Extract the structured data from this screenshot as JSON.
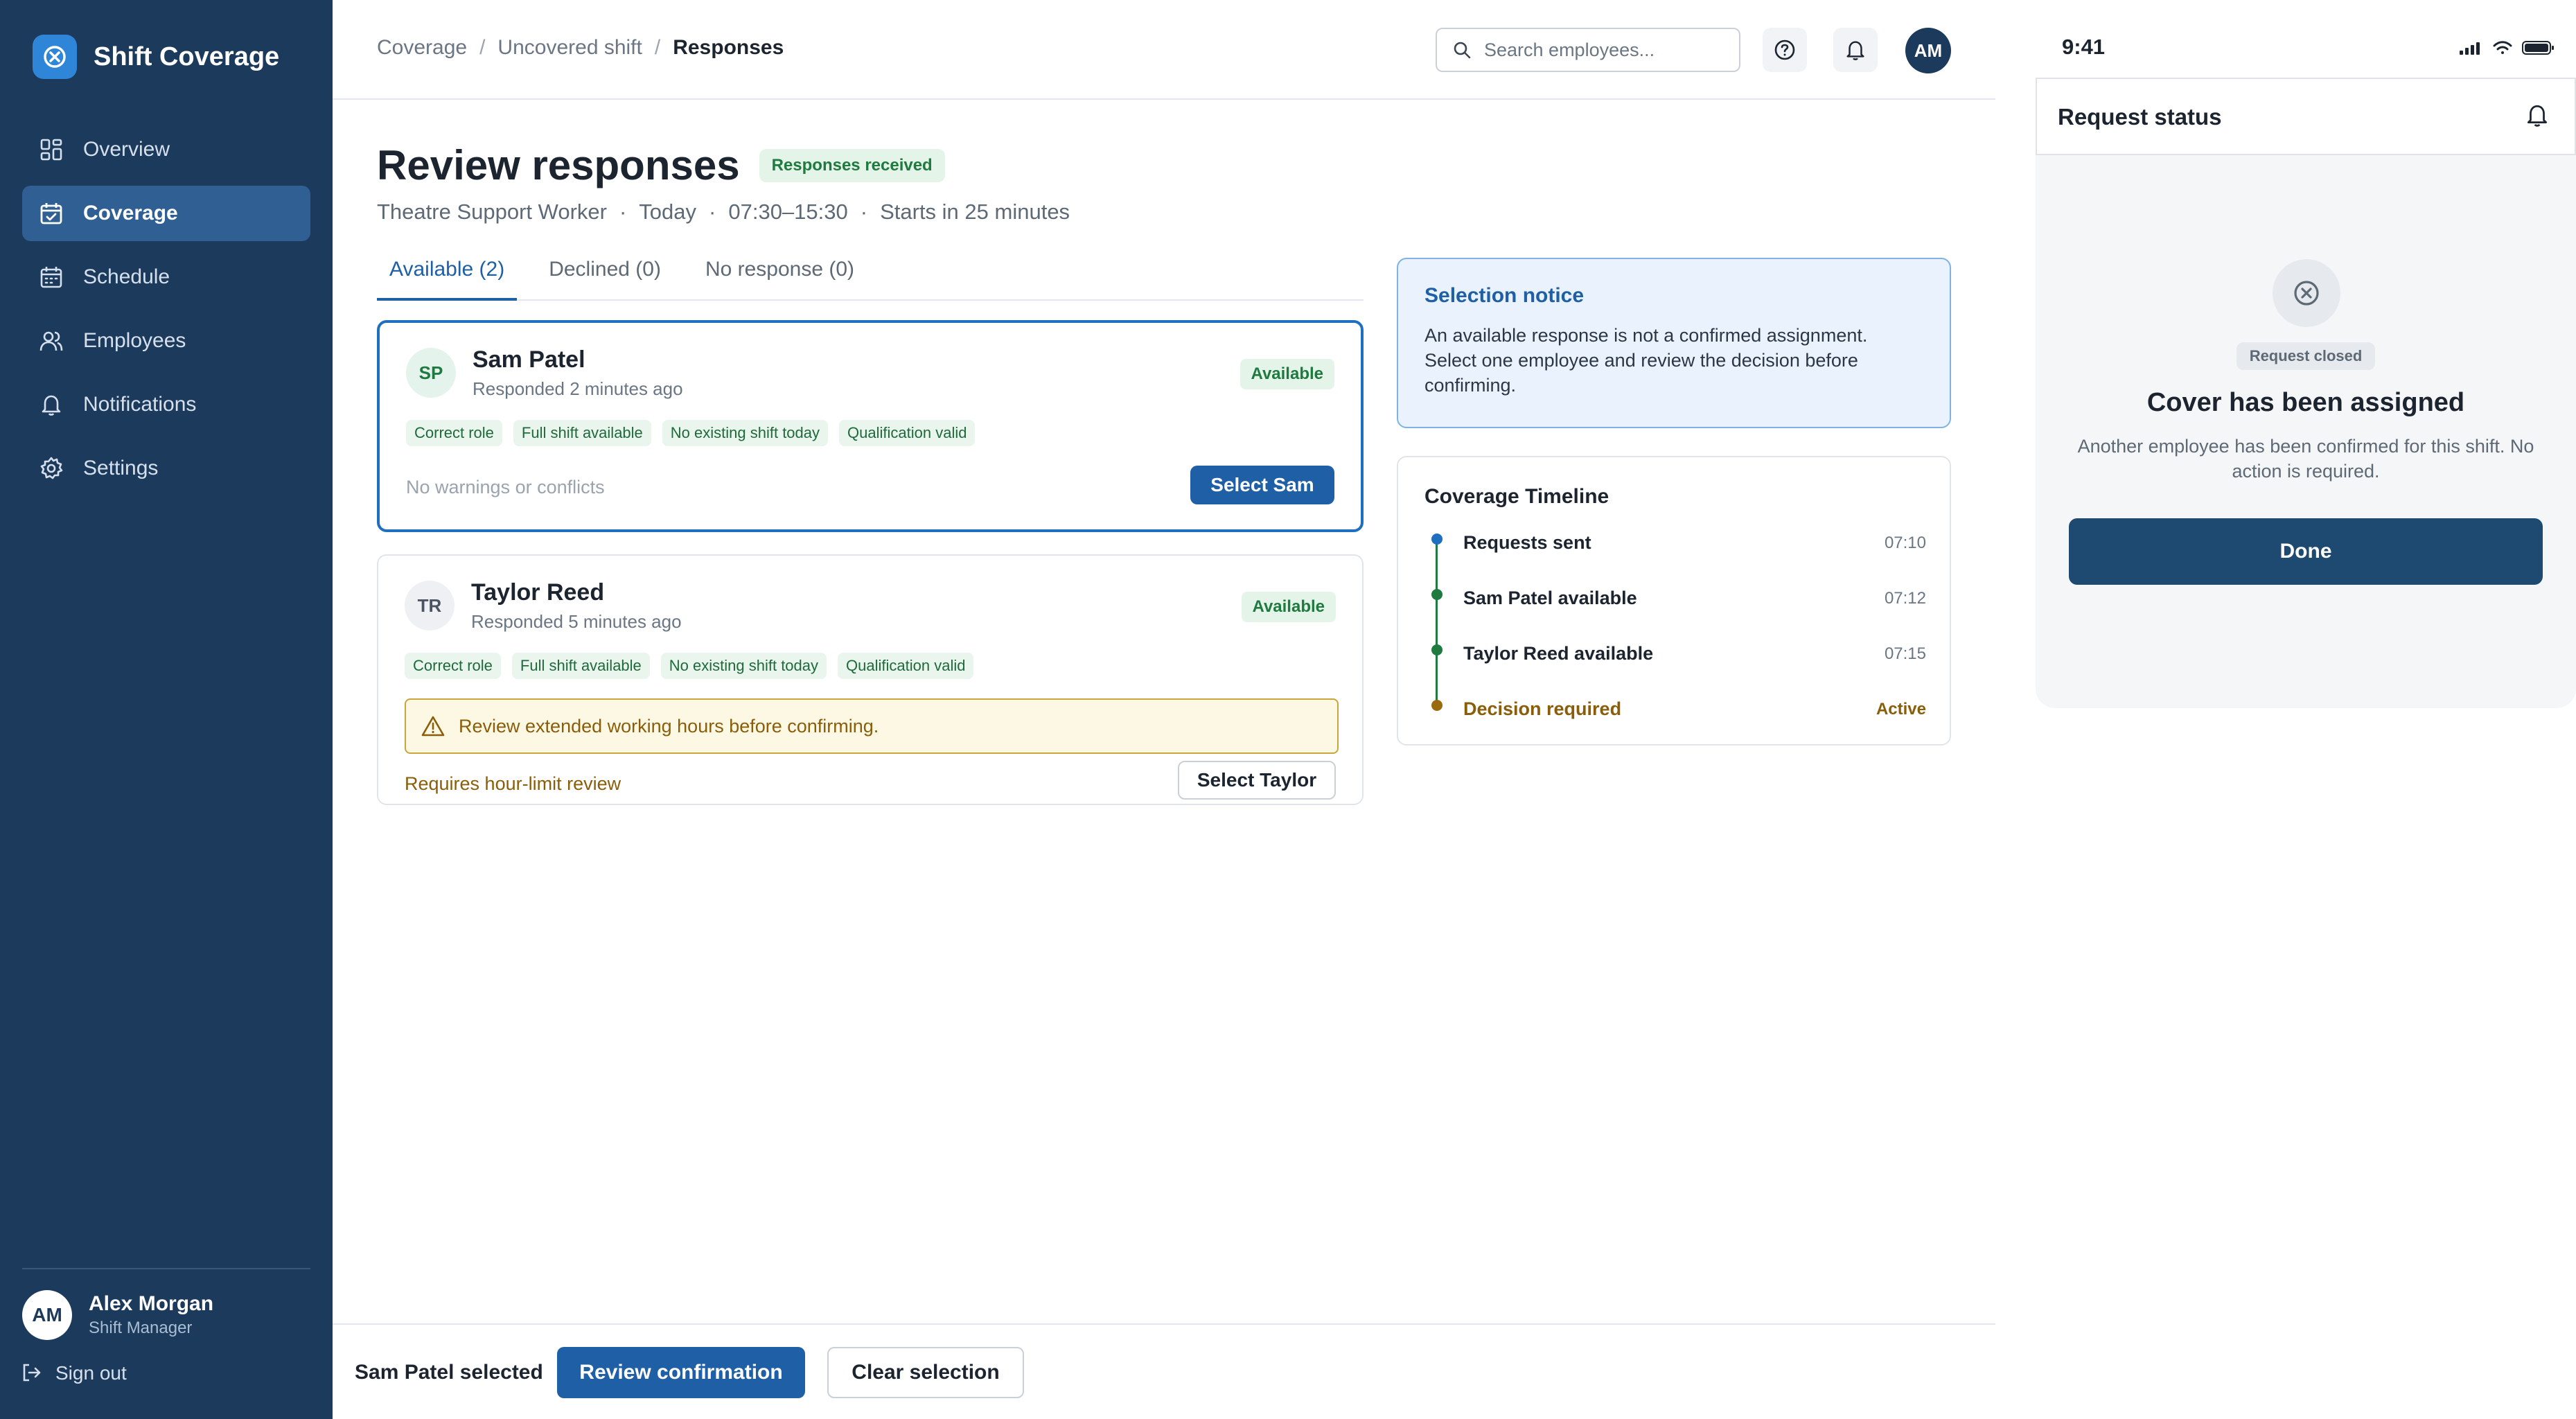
{
  "app": {
    "name": "Shift Coverage"
  },
  "sidebar": {
    "items": [
      {
        "label": "Overview",
        "icon": "grid-icon"
      },
      {
        "label": "Coverage",
        "icon": "calendar-check-icon"
      },
      {
        "label": "Schedule",
        "icon": "calendar-icon"
      },
      {
        "label": "Employees",
        "icon": "users-icon"
      },
      {
        "label": "Notifications",
        "icon": "bell-icon"
      },
      {
        "label": "Settings",
        "icon": "gear-icon"
      }
    ],
    "active": "Coverage",
    "user": {
      "initials": "AM",
      "name": "Alex Morgan",
      "role": "Shift Manager"
    },
    "signout_label": "Sign out"
  },
  "topbar": {
    "breadcrumb": [
      "Coverage",
      "Uncovered shift",
      "Responses"
    ],
    "search_placeholder": "Search employees...",
    "avatar_initials": "AM"
  },
  "page": {
    "title": "Review responses",
    "status_badge": "Responses received",
    "subtitle": [
      "Theatre Support Worker",
      "Today",
      "07:30–15:30",
      "Starts in 25 minutes"
    ],
    "subtitle_separator": "·"
  },
  "tabs": [
    {
      "label": "Available (2)",
      "active": true
    },
    {
      "label": "Declined (0)",
      "active": false
    },
    {
      "label": "No response (0)",
      "active": false
    }
  ],
  "responses": [
    {
      "initials": "SP",
      "name": "Sam Patel",
      "responded": "Responded 2 minutes ago",
      "status": "Available",
      "chips": [
        "Correct role",
        "Full shift available",
        "No existing shift today",
        "Qualification valid"
      ],
      "footnote": "No warnings or conflicts",
      "action": "Select Sam",
      "selected": true
    },
    {
      "initials": "TR",
      "name": "Taylor Reed",
      "responded": "Responded 5 minutes ago",
      "status": "Available",
      "chips": [
        "Correct role",
        "Full shift available",
        "No existing shift today",
        "Qualification valid"
      ],
      "warning": "Review extended working hours before confirming.",
      "footnote": "Requires hour-limit review",
      "action": "Select Taylor",
      "selected": false
    }
  ],
  "notice": {
    "title": "Selection notice",
    "body": "An available response is not a confirmed assignment. Select one employee and review the decision before confirming."
  },
  "timeline": {
    "title": "Coverage Timeline",
    "events": [
      {
        "label": "Requests sent",
        "time": "07:10",
        "state": "done-blue"
      },
      {
        "label": "Sam Patel available",
        "time": "07:12",
        "state": "done"
      },
      {
        "label": "Taylor Reed available",
        "time": "07:15",
        "state": "done"
      },
      {
        "label": "Decision required",
        "time": "Active",
        "state": "active"
      }
    ]
  },
  "bottombar": {
    "selection_text": "Sam Patel selected",
    "primary": "Review confirmation",
    "secondary": "Clear selection"
  },
  "mobile": {
    "time": "9:41",
    "header_title": "Request status",
    "badge": "Request closed",
    "heading": "Cover has been assigned",
    "body": "Another employee has been confirmed for this shift. No action is required.",
    "done_label": "Done"
  },
  "colors": {
    "sidebar": "#1c3a5c",
    "primary": "#1e5fa5",
    "success": "#1f7a3f",
    "warning": "#8a5d0a",
    "notice_bg": "#eaf3fd"
  }
}
